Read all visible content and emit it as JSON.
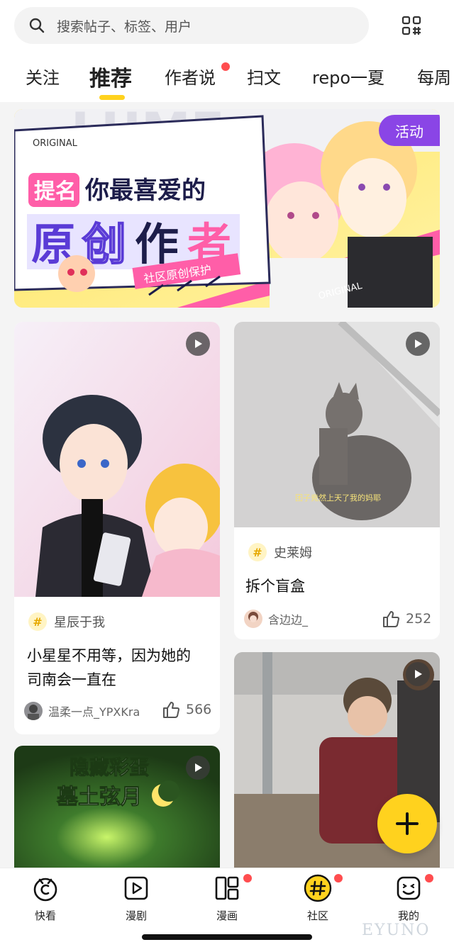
{
  "search": {
    "placeholder": "搜索帖子、标签、用户",
    "icon": "search-icon",
    "scan_icon": "qr-scan-icon"
  },
  "tabs": [
    {
      "label": "关注",
      "active": false
    },
    {
      "label": "推荐",
      "active": true
    },
    {
      "label": "作者说",
      "active": false,
      "dot": true
    },
    {
      "label": "扫文",
      "active": false
    },
    {
      "label": "repo一夏",
      "active": false
    },
    {
      "label": "每周",
      "active": false
    }
  ],
  "banner": {
    "badge": "活动",
    "tiny": "ORIGINAL",
    "line1_a": "提名",
    "line1_b": "你最喜爱的",
    "line2": [
      "原",
      "创",
      "作",
      "者"
    ],
    "ribbon": "社区原创保护",
    "strip": "ORIGINAL"
  },
  "cards": [
    {
      "tag": "星辰于我",
      "title_line1": "小星星不用等，因为她的",
      "title_line2": "司南会一直在",
      "author": "温柔一点_YPXKra",
      "likes": "566",
      "has_play": true
    },
    {
      "tag": "史莱姆",
      "title_line1": "拆个盲盒",
      "author": "含边边_",
      "likes": "252",
      "has_play": true,
      "caption": "团子竟然上天了我的妈耶"
    },
    {
      "overlay_line1": "隐藏彩蛋",
      "overlay_line2": "墓土弦月",
      "has_play": true
    },
    {
      "has_play": true
    }
  ],
  "nav": [
    {
      "label": "快看",
      "icon": "kuaikan-icon",
      "dot": false
    },
    {
      "label": "漫剧",
      "icon": "play-video-icon",
      "dot": false
    },
    {
      "label": "漫画",
      "icon": "comic-book-icon",
      "dot": true
    },
    {
      "label": "社区",
      "icon": "community-hash-icon",
      "dot": true,
      "active": true
    },
    {
      "label": "我的",
      "icon": "profile-smile-icon",
      "dot": true
    }
  ],
  "watermark": "EYUNO",
  "colors": {
    "accent": "#ffd21e",
    "badge": "#8a45e6",
    "dot": "#ff4d4f"
  }
}
